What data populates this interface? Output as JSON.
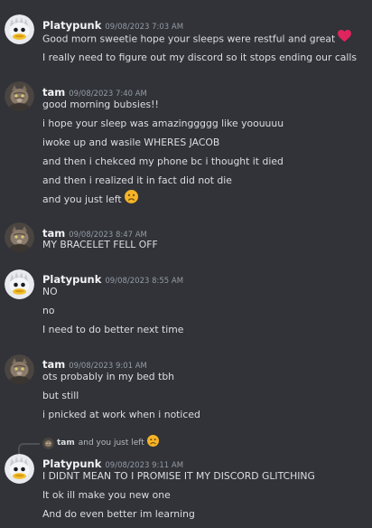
{
  "messages": [
    {
      "author": "Platypunk",
      "timestamp": "09/08/2023 7:03 AM",
      "avatar_icon": "platypunk-avatar",
      "lines": [
        "Good morn sweetie hope your sleeps were restful and great",
        "I really need to figure out my discord so it stops ending our calls"
      ]
    },
    {
      "author": "tam",
      "timestamp": "09/08/2023 7:40 AM",
      "avatar_icon": "cat-avatar",
      "lines": [
        "good morning bubsies!!",
        "i hope your sleep was amazinggggg like yoouuuu",
        "iwoke up and wasile WHERES JACOB",
        "and then i chekced my phone bc i thought it died",
        "and then i realized it in fact did not die",
        "and you just left"
      ]
    },
    {
      "author": "tam",
      "timestamp": "09/08/2023 8:47 AM",
      "avatar_icon": "cat-avatar",
      "lines": [
        "MY BRACELET FELL OFF"
      ]
    },
    {
      "author": "Platypunk",
      "timestamp": "09/08/2023 8:55 AM",
      "avatar_icon": "platypunk-avatar",
      "lines": [
        "NO",
        "no",
        "I need to do better next time"
      ]
    },
    {
      "author": "tam",
      "timestamp": "09/08/2023 9:01 AM",
      "avatar_icon": "cat-avatar",
      "lines": [
        "ots probably in my bed tbh",
        "but still",
        "i pnicked at work when i noticed"
      ]
    },
    {
      "author": "Platypunk",
      "timestamp": "09/08/2023 9:11 AM",
      "avatar_icon": "platypunk-avatar",
      "reply_to": {
        "author": "tam",
        "text": "and you just left"
      },
      "lines": [
        "I DIDNT MEAN TO I PROMISE IT MY DISCORD GLITCHING",
        "It ok ill make you new one",
        "And do even better im learning"
      ]
    }
  ],
  "emoji": {
    "heart": "red-heart-emoji",
    "sad": "frowning-face-emoji"
  },
  "colors": {
    "background": "#313338",
    "username": "#f2f3f5",
    "text": "#dbdee1",
    "timestamp": "#949ba4",
    "heart": "#e0245e",
    "sad_face": "#f5b427"
  }
}
